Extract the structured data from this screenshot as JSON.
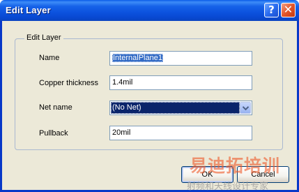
{
  "window": {
    "title": "Edit Layer"
  },
  "titlebar_buttons": {
    "help_glyph": "?",
    "close_glyph": "✕"
  },
  "group": {
    "title": "Edit Layer"
  },
  "fields": {
    "name": {
      "label": "Name",
      "value": "InternalPlane1"
    },
    "copper_thickness": {
      "label": "Copper thickness",
      "value": "1.4mil"
    },
    "net_name": {
      "label": "Net name",
      "value": "(No Net)"
    },
    "pullback": {
      "label": "Pullback",
      "value": "20mil"
    }
  },
  "buttons": {
    "ok": "OK",
    "cancel": "Cancel"
  },
  "watermark": {
    "main": "易迪拓培训",
    "sub": "射频和天线设计专家"
  },
  "colors": {
    "title_bar": "#0a5ce8",
    "dialog_bg": "#ece9d8",
    "selection": "#316ac5",
    "combo_selection": "#0a246a",
    "watermark": "#ef5a2a"
  }
}
